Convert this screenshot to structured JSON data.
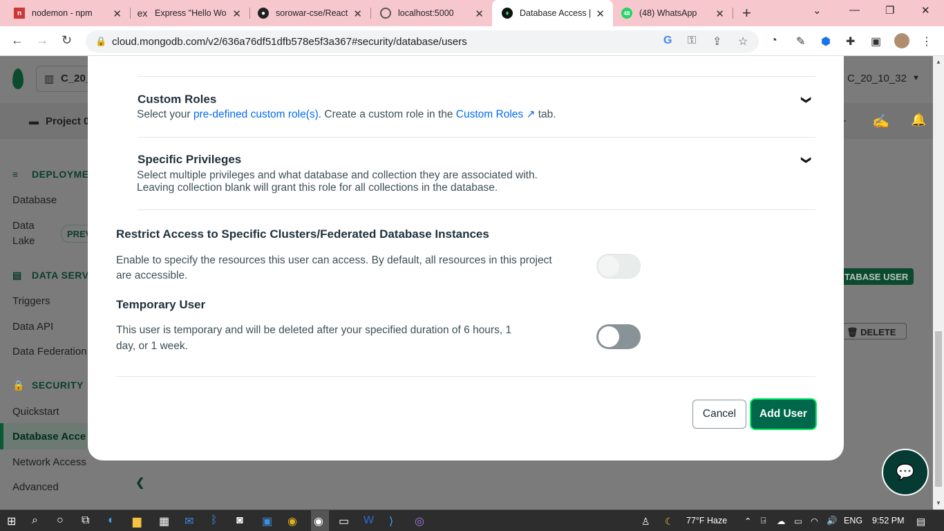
{
  "browser": {
    "tabs": [
      {
        "title": "nodemon - npm",
        "icon": "npm-icon"
      },
      {
        "title": "Express \"Hello Wo",
        "icon": "express-icon"
      },
      {
        "title": "sorowar-cse/React",
        "icon": "github-icon"
      },
      {
        "title": "localhost:5000",
        "icon": "globe-icon"
      },
      {
        "title": "Database Access |",
        "icon": "mongodb-leaf-icon"
      },
      {
        "title": "(48) WhatsApp",
        "icon": "whatsapp-icon",
        "badge": "48"
      }
    ],
    "url": "cloud.mongodb.com/v2/636a76df51dfb578e5f3a367#security/database/users"
  },
  "background": {
    "org": "C_20_",
    "org_right": "C_20_10_32",
    "project": "Project 0",
    "sidebar": {
      "deployment_header": "DEPLOYMENT",
      "database": "Database",
      "data_lake_1": "Data",
      "data_lake_2": "Lake",
      "preview": "PREV",
      "data_services_header": "DATA SERVI",
      "triggers": "Triggers",
      "data_api": "Data API",
      "data_federation": "Data Federation",
      "security_header": "SECURITY",
      "quickstart": "Quickstart",
      "database_access": "Database Acce",
      "network_access": "Network Access",
      "advanced": "Advanced"
    },
    "add_db_user": "TABASE USER",
    "delete": "DELETE"
  },
  "modal": {
    "custom_roles": {
      "title": "Custom Roles",
      "desc_prefix": "Select your ",
      "link1": "pre-defined custom role(s)",
      "desc_mid": ". Create a custom role in the ",
      "link2": "Custom Roles",
      "desc_suffix": " tab."
    },
    "specific_privileges": {
      "title": "Specific Privileges",
      "line1": "Select multiple privileges and what database and collection they are associated with.",
      "line2": "Leaving collection blank will grant this role for all collections in the database."
    },
    "restrict": {
      "title": "Restrict Access to Specific Clusters/Federated Database Instances",
      "line1": "Enable to specify the resources this user can access. By default, all resources in this project",
      "line2": "are accessible.",
      "enabled": false
    },
    "temporary": {
      "title": "Temporary User",
      "line1": "This user is temporary and will be deleted after your specified duration of 6 hours, 1",
      "line2": "day, or 1 week.",
      "enabled": false
    },
    "cancel": "Cancel",
    "add_user": "Add User"
  },
  "taskbar": {
    "weather": "77°F  Haze",
    "lang": "ENG",
    "time": "9:52 PM"
  }
}
